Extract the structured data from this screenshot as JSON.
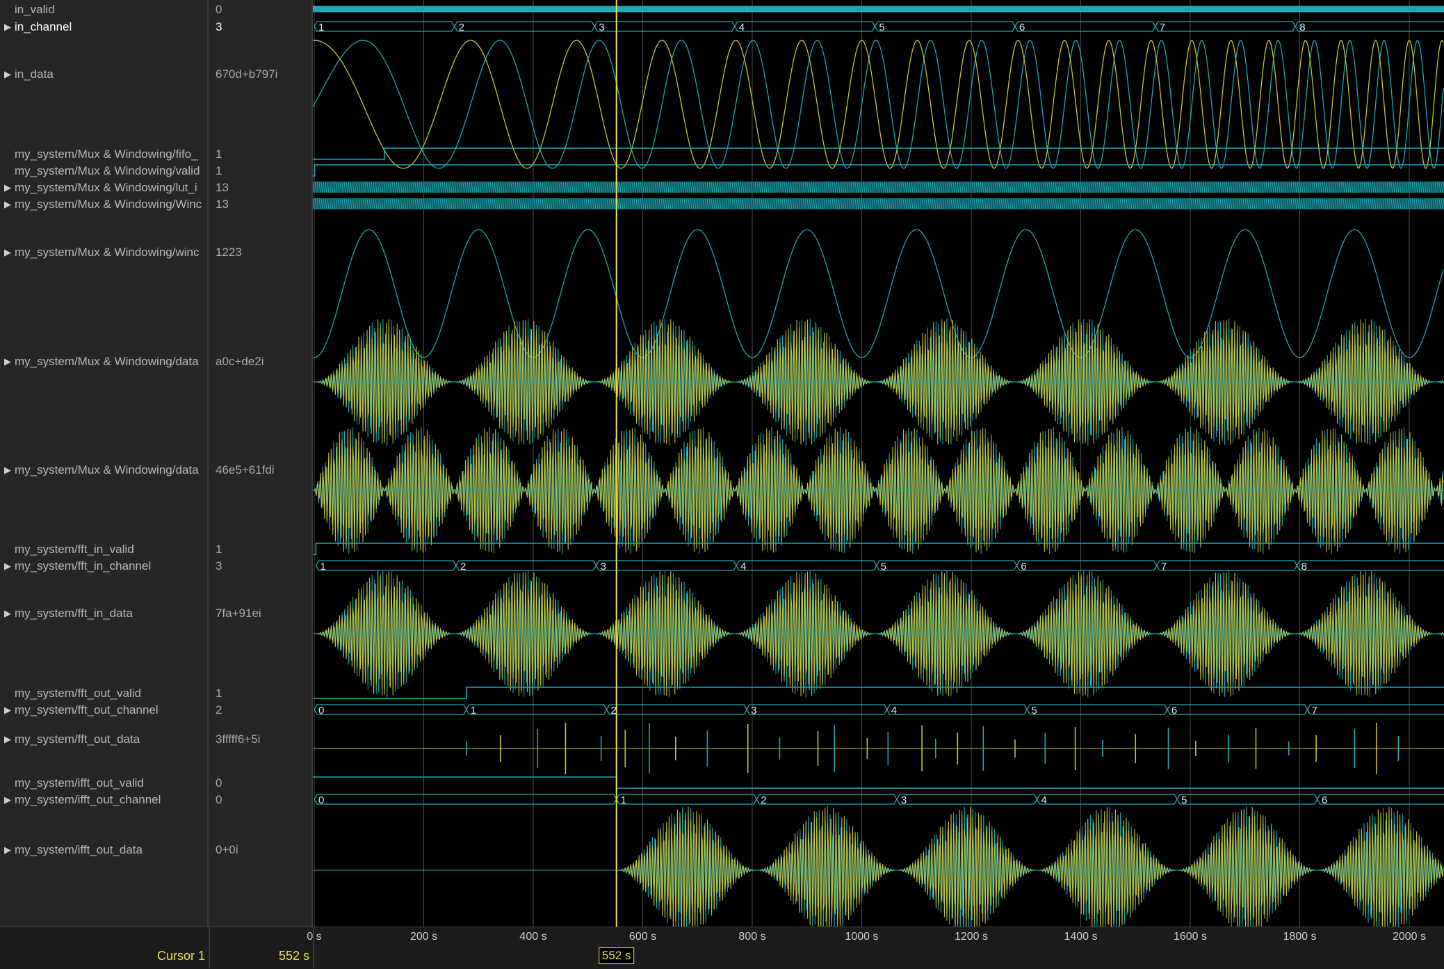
{
  "signals": [
    {
      "name": "in_valid",
      "value": "0",
      "expandable": false,
      "selected": false
    },
    {
      "name": "in_channel",
      "value": "3",
      "expandable": true,
      "selected": true
    },
    {
      "name": "in_data",
      "value": "670d+b797i",
      "expandable": true,
      "selected": false
    },
    {
      "name": "my_system/Mux & Windowing/fifo_",
      "value": "1",
      "expandable": false,
      "selected": false
    },
    {
      "name": "my_system/Mux & Windowing/valid",
      "value": "1",
      "expandable": false,
      "selected": false
    },
    {
      "name": "my_system/Mux & Windowing/lut_i",
      "value": "13",
      "expandable": true,
      "selected": false
    },
    {
      "name": "my_system/Mux & Windowing/Winc",
      "value": "13",
      "expandable": true,
      "selected": false
    },
    {
      "name": "my_system/Mux & Windowing/winc",
      "value": "1223",
      "expandable": true,
      "selected": false
    },
    {
      "name": "my_system/Mux & Windowing/data",
      "value": "a0c+de2i",
      "expandable": true,
      "selected": false
    },
    {
      "name": "my_system/Mux & Windowing/data",
      "value": "46e5+61fdi",
      "expandable": true,
      "selected": false
    },
    {
      "name": "my_system/fft_in_valid",
      "value": "1",
      "expandable": false,
      "selected": false
    },
    {
      "name": "my_system/fft_in_channel",
      "value": "3",
      "expandable": true,
      "selected": false
    },
    {
      "name": "my_system/fft_in_data",
      "value": "7fa+91ei",
      "expandable": true,
      "selected": false
    },
    {
      "name": "my_system/fft_out_valid",
      "value": "1",
      "expandable": false,
      "selected": false
    },
    {
      "name": "my_system/fft_out_channel",
      "value": "2",
      "expandable": true,
      "selected": false
    },
    {
      "name": "my_system/fft_out_data",
      "value": "3fffff6+5i",
      "expandable": true,
      "selected": false
    },
    {
      "name": "my_system/ifft_out_valid",
      "value": "0",
      "expandable": false,
      "selected": false
    },
    {
      "name": "my_system/ifft_out_channel",
      "value": "0",
      "expandable": true,
      "selected": false
    },
    {
      "name": "my_system/ifft_out_data",
      "value": "0+0i",
      "expandable": true,
      "selected": false
    }
  ],
  "bus_labels": {
    "in_channel": [
      "1",
      "2",
      "3",
      "4",
      "5",
      "6",
      "7",
      "8"
    ],
    "fft_in_channel": [
      "1",
      "2",
      "3",
      "4",
      "5",
      "6",
      "7",
      "8"
    ],
    "fft_out_channel": [
      "0",
      "1",
      "2",
      "3",
      "4",
      "5",
      "6",
      "7"
    ],
    "ifft_out_channel": [
      "0",
      "1",
      "2",
      "3",
      "4",
      "5",
      "6"
    ]
  },
  "time_axis": {
    "ticks": [
      "0 s",
      "200 s",
      "400 s",
      "600 s",
      "800 s",
      "1000 s",
      "1200 s",
      "1400 s",
      "1600 s",
      "1800 s",
      "2000 s"
    ]
  },
  "cursor": {
    "label": "Cursor 1",
    "value": "552 s",
    "time": 552
  },
  "colors": {
    "teal": "#1fa9b5",
    "yellow": "#c9c53a",
    "cursor": "#f0e24b",
    "grid": "#4a4a4a",
    "panel": "#262626"
  }
}
